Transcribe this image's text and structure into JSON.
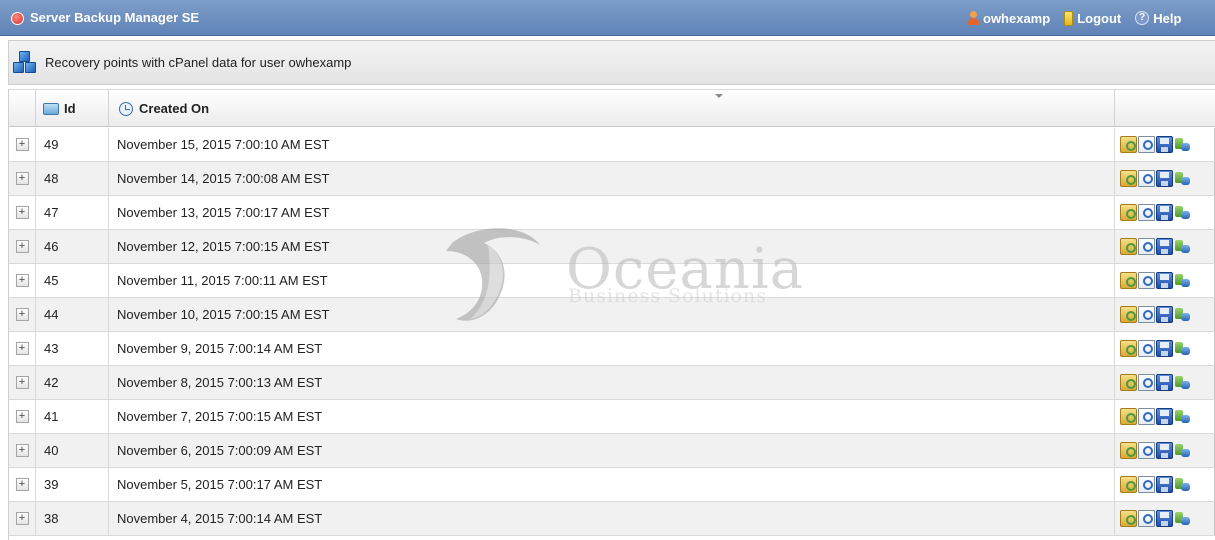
{
  "app": {
    "title": "Server Backup Manager SE",
    "username": "owhexamp",
    "logout_label": "Logout",
    "help_label": "Help"
  },
  "subheader": {
    "text": "Recovery points with cPanel data for user owhexamp"
  },
  "grid": {
    "columns": {
      "id": "Id",
      "created_on": "Created On"
    },
    "rows": [
      {
        "id": "49",
        "created_on": "November 15, 2015 7:00:10 AM EST"
      },
      {
        "id": "48",
        "created_on": "November 14, 2015 7:00:08 AM EST"
      },
      {
        "id": "47",
        "created_on": "November 13, 2015 7:00:17 AM EST"
      },
      {
        "id": "46",
        "created_on": "November 12, 2015 7:00:15 AM EST"
      },
      {
        "id": "45",
        "created_on": "November 11, 2015 7:00:11 AM EST"
      },
      {
        "id": "44",
        "created_on": "November 10, 2015 7:00:15 AM EST"
      },
      {
        "id": "43",
        "created_on": "November 9, 2015 7:00:14 AM EST"
      },
      {
        "id": "42",
        "created_on": "November 8, 2015 7:00:13 AM EST"
      },
      {
        "id": "41",
        "created_on": "November 7, 2015 7:00:15 AM EST"
      },
      {
        "id": "40",
        "created_on": "November 6, 2015 7:00:09 AM EST"
      },
      {
        "id": "39",
        "created_on": "November 5, 2015 7:00:17 AM EST"
      },
      {
        "id": "38",
        "created_on": "November 4, 2015 7:00:14 AM EST"
      }
    ],
    "expand_symbol": "+",
    "row_actions": [
      "browse-files-icon",
      "view-icon",
      "save-icon",
      "restore-icon"
    ]
  },
  "watermark": {
    "name": "Oceania",
    "tagline": "Business Solutions"
  },
  "colors": {
    "topbar": "#6a8dbf",
    "row_alt": "#f1f1f1",
    "border": "#dadada"
  }
}
